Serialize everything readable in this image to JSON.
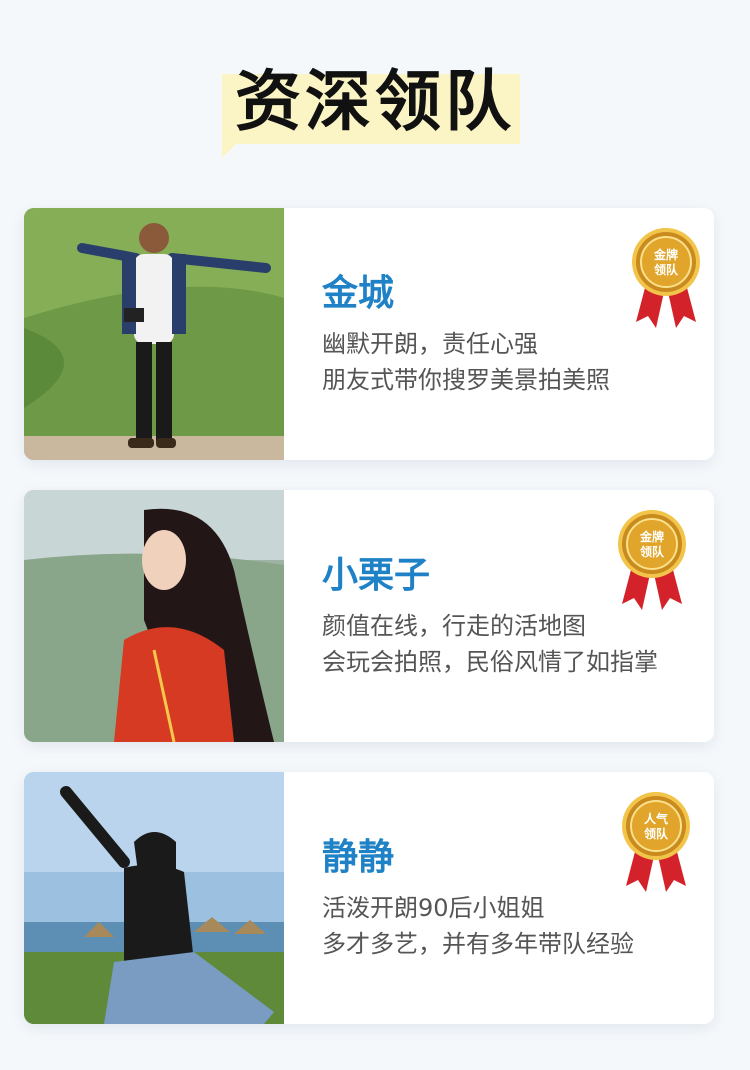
{
  "page": {
    "title": "资深领队"
  },
  "leaders": [
    {
      "name": "金城",
      "lines": [
        "幽默开朗，责任心强",
        "朋友式带你搜罗美景拍美照"
      ],
      "badge": [
        "金牌",
        "领队"
      ]
    },
    {
      "name": "小栗子",
      "lines": [
        "颜值在线，行走的活地图",
        "会玩会拍照，民俗风情了如指掌"
      ],
      "badge": [
        "金牌",
        "领队"
      ]
    },
    {
      "name": "静静",
      "lines": [
        "活泼开朗90后小姐姐",
        "多才多艺，并有多年带队经验"
      ],
      "badge": [
        "人气",
        "领队"
      ]
    }
  ],
  "colors": {
    "accent": "#1f82c6",
    "title_highlight": "#fbf4c4",
    "medal_gold": "#e0a52a",
    "ribbon_red": "#d4222a"
  }
}
